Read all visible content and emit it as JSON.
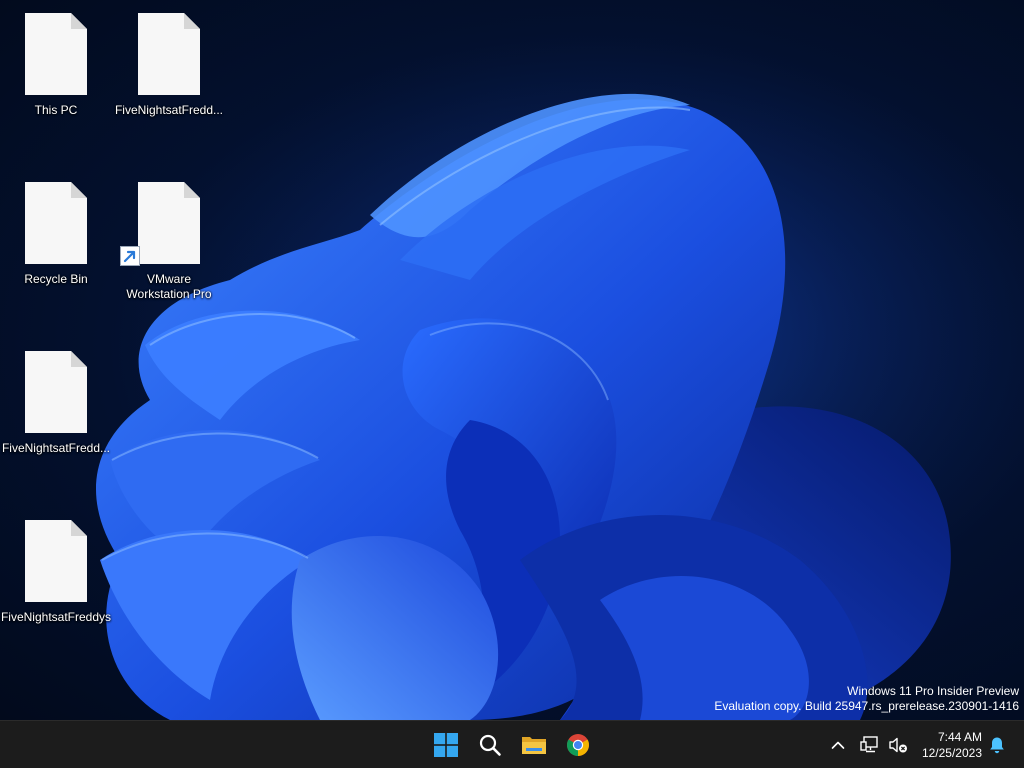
{
  "desktop": {
    "icons": [
      {
        "label": "This PC",
        "icon": "file-icon"
      },
      {
        "label": "FiveNightsatFredd...",
        "icon": "file-icon"
      },
      {
        "label": "Recycle Bin",
        "icon": "file-icon"
      },
      {
        "label": "VMware Workstation Pro",
        "icon": "file-icon",
        "shortcut": true
      },
      {
        "label": "FiveNightsatFredd...",
        "icon": "file-icon"
      },
      {
        "label": "FiveNightsatFreddys",
        "icon": "file-icon"
      }
    ]
  },
  "watermark": {
    "line1": "Windows 11 Pro Insider Preview",
    "line2": "Evaluation copy. Build 25947.rs_prerelease.230901-1416"
  },
  "taskbar": {
    "pinned": [
      "windows-start-icon",
      "search-icon",
      "file-explorer-icon",
      "chrome-icon"
    ],
    "tray": [
      "chevron-up-icon",
      "network-icon",
      "volume-muted-icon",
      "notification-bell-icon"
    ],
    "clock": {
      "time": "7:44 AM",
      "date": "12/25/2023"
    }
  },
  "colors": {
    "taskbar_bg": "#1c1c1c",
    "wallpaper_accent": "#1f5ff0",
    "start_blue": "#34a7f0",
    "folder_yellow": "#f4c542",
    "bell_blue": "#4cc2ff"
  }
}
